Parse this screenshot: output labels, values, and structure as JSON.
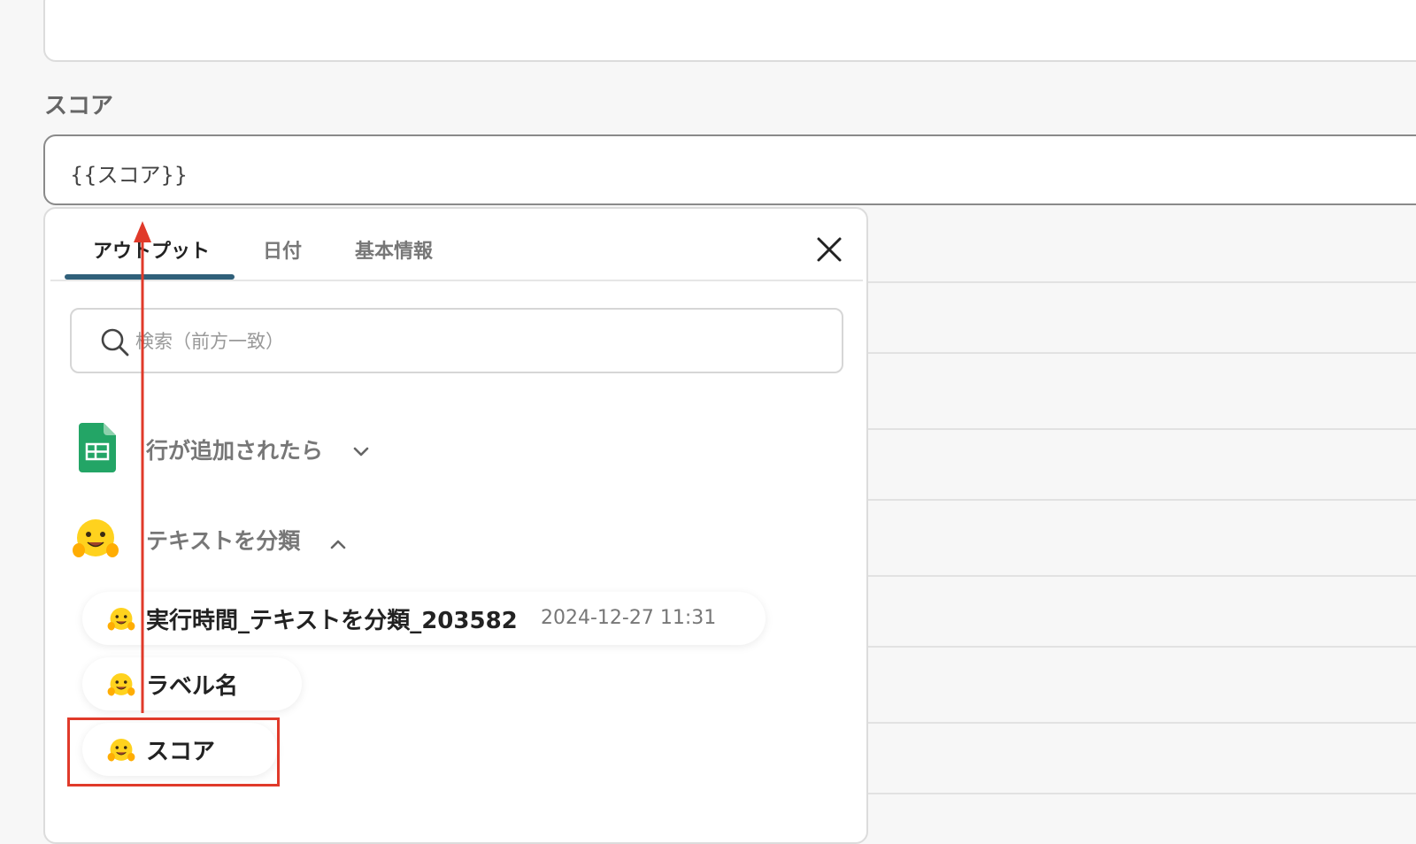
{
  "form": {
    "field_label": "スコア",
    "score_value": "{{スコア}}"
  },
  "panel": {
    "tabs": [
      {
        "label": "アウトプット",
        "active": true
      },
      {
        "label": "日付",
        "active": false
      },
      {
        "label": "基本情報",
        "active": false
      }
    ],
    "close_icon": "close-icon",
    "search": {
      "placeholder": "検索（前方一致）",
      "value": ""
    },
    "groups": [
      {
        "title": "行が追加されたら",
        "icon": "google-sheets-icon",
        "expanded": false
      },
      {
        "title": "テキストを分類",
        "icon": "hugging-face-icon",
        "expanded": true
      }
    ],
    "items": [
      {
        "label": "実行時間_テキストを分類_203582",
        "date": "2024-12-27 11:31"
      },
      {
        "label": "ラベル名"
      },
      {
        "label": "スコア",
        "highlighted": true
      }
    ]
  },
  "colors": {
    "tab_indicator": "#30607a",
    "annotation_red": "#e03a2a",
    "sheets_green": "#23a566"
  }
}
